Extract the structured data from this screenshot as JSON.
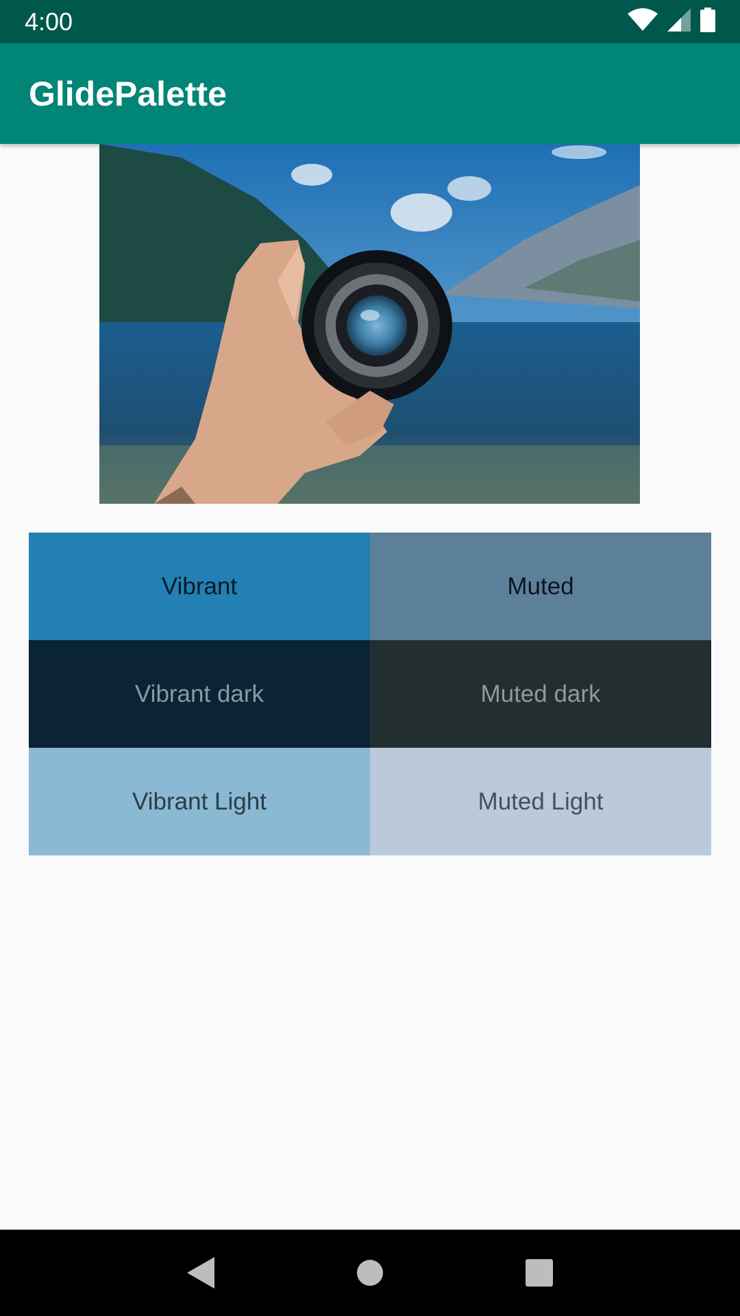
{
  "status_bar": {
    "time": "4:00",
    "icons": [
      "wifi-icon",
      "cell-signal-icon",
      "battery-icon"
    ],
    "background": "#00574B"
  },
  "app_bar": {
    "title": "GlidePalette",
    "background": "#008577"
  },
  "image": {
    "description_icon": "lens-photo"
  },
  "palette": [
    {
      "label": "Vibrant",
      "bg": "#2280B4",
      "fg": "#0A1A24"
    },
    {
      "label": "Muted",
      "bg": "#5C7F9A",
      "fg": "#0B1620"
    },
    {
      "label": "Vibrant dark",
      "bg": "#0A2435",
      "fg": "#8A9AA4"
    },
    {
      "label": "Muted dark",
      "bg": "#222E30",
      "fg": "#8E9A9C"
    },
    {
      "label": "Vibrant Light",
      "bg": "#8BB8D2",
      "fg": "#2A3E4A"
    },
    {
      "label": "Muted Light",
      "bg": "#BACADB",
      "fg": "#44505C"
    }
  ],
  "nav_bar": {
    "buttons": [
      "back-icon",
      "home-icon",
      "recents-icon"
    ]
  }
}
